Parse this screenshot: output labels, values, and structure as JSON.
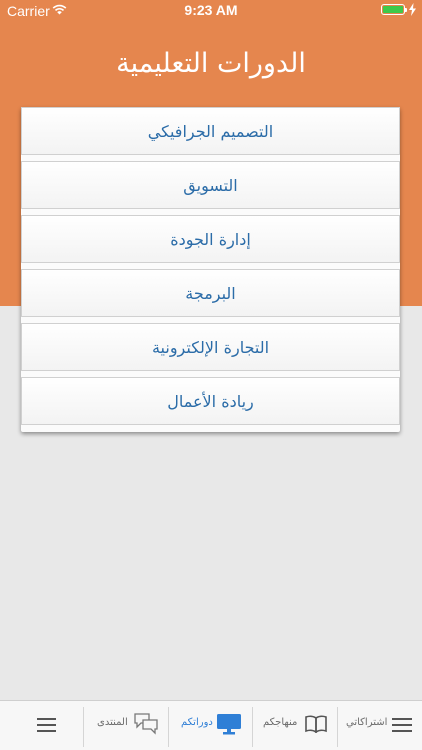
{
  "status_bar": {
    "carrier": "Carrier",
    "time": "9:23 AM"
  },
  "header": {
    "title": "الدورات التعليمية"
  },
  "courses": [
    {
      "label": "التصميم الجرافيكي"
    },
    {
      "label": "التسويق"
    },
    {
      "label": "إدارة الجودة"
    },
    {
      "label": "البرمجة"
    },
    {
      "label": "التجارة الإلكترونية"
    },
    {
      "label": "ريادة الأعمال"
    }
  ],
  "tab_bar": {
    "tabs": [
      {
        "label": "اشتراكاتي",
        "icon": "list-icon"
      },
      {
        "label": "منهاجكم",
        "icon": "book-icon"
      },
      {
        "label": "دوراتكم",
        "icon": "monitor-icon",
        "active": true
      },
      {
        "label": "المنتدى",
        "icon": "chat-bubbles-icon"
      },
      {
        "label": "",
        "icon": "menu-icon"
      }
    ]
  },
  "colors": {
    "header": "#e5864e",
    "accent": "#2f7fd6",
    "course_text": "#2b6ca8",
    "background": "#e8e8e8"
  }
}
